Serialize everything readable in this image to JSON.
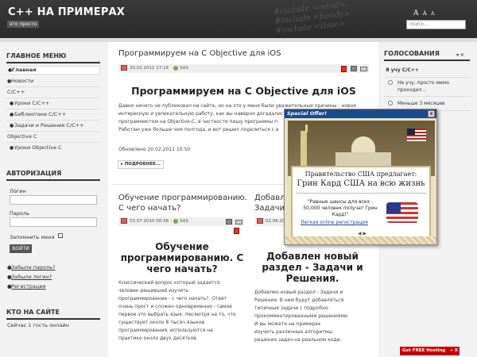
{
  "header": {
    "logo": "C++ НА ПРИМЕРАХ",
    "tagline": "это просто",
    "code_lines": [
      "#include <mtod>",
      "#include <bonds>",
      "#include <time>"
    ],
    "font_sizes": [
      "A",
      "A",
      "A"
    ],
    "search_placeholder": "поиск..."
  },
  "sidebar": {
    "main_menu_title": "ГЛАВНОЕ МЕНЮ",
    "menu": [
      {
        "label": "Главная",
        "active": true
      },
      {
        "label": "Новости"
      },
      {
        "label": "C/C++"
      },
      {
        "label": "Уроки C/C++"
      },
      {
        "label": "Библиотеки C/C++"
      },
      {
        "label": "Задачи и Решения C/C++"
      },
      {
        "label": "Objective C"
      },
      {
        "label": "Уроки Objective C"
      }
    ],
    "auth_title": "АВТОРИЗАЦИЯ",
    "login_label": "Логин",
    "password_label": "Пароль",
    "remember_label": "Запомнить меня",
    "login_button": "ВОЙТИ",
    "links": [
      "Забыли пароль?",
      "Забыли логин?",
      "Регистрация"
    ],
    "online_title": "КТО НА САЙТЕ",
    "online_text": "Сейчас 1 гость онлайн"
  },
  "main": {
    "article1": {
      "title": "Программируем на C Objective для iOS",
      "date": "20.02.2011 17:16",
      "author": "SAS",
      "heading": "Программируем на C Objective для iOS",
      "text_lines": [
        "Давно ничего не публиковал на сайте, но на это у меня были уважительные причины - новая",
        "интересную и увлекательную работу, как вы наверно догадались я",
        "программистом на Objective-C, в частности пишу программы п",
        "Работаю уже больше чем полгода, и вот решил поделиться с в"
      ],
      "updated": "Обновлено 20.02.2011 10:50",
      "more": "ПОДРОБНЕЕ..."
    },
    "article2": {
      "title_lines": [
        "Обучение программированию.",
        "С чего начать?"
      ],
      "date": "03.07.2010 00:36",
      "author": "SAS",
      "heading_lines": [
        "Обучение",
        "программированию. С",
        "чего начать?"
      ],
      "text_lines": [
        "Классический вопрос который задается",
        "человек решивший изучить",
        "программирование - с чего начать?. Ответ",
        "очень прост и сложен одновременно - самое",
        "первое это выбрать язык. Несмотря на то, что",
        "существует около 8 тысяч языков",
        "программирования, используются на",
        "практике около двух десятков."
      ]
    },
    "article3": {
      "title_lines": [
        "Добавле",
        "Задачи"
      ],
      "date": "02.06.20",
      "heading_lines": [
        "Добавлен новый",
        "раздел - Задачи и",
        "Решения."
      ],
      "text_lines": [
        "Добавлен новый раздел - Задачи и",
        "Решения. В нем будут добавляться",
        "типичные задачи с подробно",
        "прокомментированными решениями.",
        "И вы можете на примерах",
        "изучить различные алгоритмы",
        "решения задач на реальном коде."
      ]
    }
  },
  "right": {
    "poll_title": "ГОЛОСОВАНИЯ",
    "close": "▾ ✕",
    "question": "Я учу C/C++",
    "options": [
      {
        "lines": [
          "Не учу, просто мимо",
          "проходил..."
        ]
      },
      {
        "lines": [
          "Меньше 3 месяцев"
        ]
      },
      {
        "lines": [
          "..."
        ]
      }
    ]
  },
  "popup": {
    "bar": "Special Offer!",
    "close": "x",
    "line1": "Правительство США предлагает:",
    "line2": "Грин Кард США на всю жизнь",
    "quote": "\"Равные шансы для всех - 50,000 человек получат Грин Кард!\"",
    "link": "Легкая online регистрация",
    "arrows": "◀ ▶"
  },
  "ad": {
    "label": "Get FREE Hosting",
    "arrows": "» X"
  },
  "colors": {
    "header_bg": "#2e2e2e",
    "popup_bar": "#1a4a8a",
    "ad_bg": "#cc0000"
  }
}
